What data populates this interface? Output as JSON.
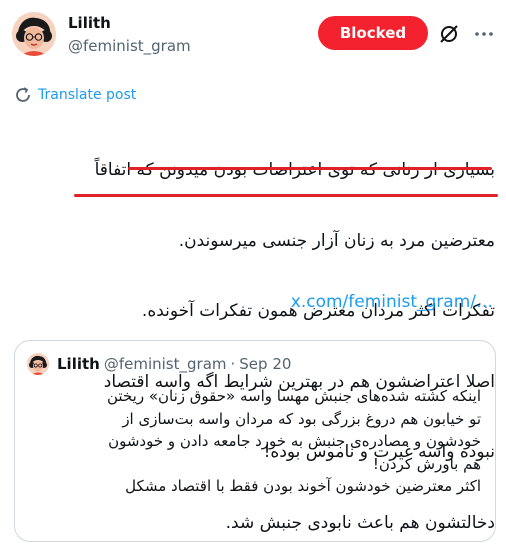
{
  "author": {
    "name": "Lilith",
    "handle": "@feminist_gram"
  },
  "actions": {
    "blocked_label": "Blocked"
  },
  "translate_label": "Translate post",
  "post_lines": [
    "بسیاری از زنانی که توی اعتراضات بودن میدونن که اتفاقاً",
    "معترضین مرد به زنان آزار جنسی میرسوندن.",
    "تفکرات اکثر مردان معترض همون تفکرات آخونده.",
    "اصلا اعتراضشون هم در بهترین شرایط اگه واسه اقتصاد",
    "نبوده واسه غیرت و ناموس بوده!",
    "دخالتشون هم باعث نابودی جنبش شد."
  ],
  "post_link": "x.com/feminist_gram/…",
  "quote": {
    "name": "Lilith",
    "handle": "@feminist_gram",
    "separator": "·",
    "date": "Sep 20",
    "lines": [
      "اینکه کشته شده‌های جنبش مهسا واسه «حقوق زنان» ریختن",
      "تو خیابون هم دروغ بزرگی بود که مردان واسه بت‌سازی از",
      "خودشون و مصادره‌ی جنبش به خورد جامعه دادن و خودشون",
      "هم باورش کردن!",
      "اکثر معترضین خودشون آخوند بودن فقط با اقتصاد مشکل"
    ]
  },
  "colors": {
    "blocked": "#f4212e",
    "link": "#1d9bf0",
    "underline": "#e02127"
  }
}
